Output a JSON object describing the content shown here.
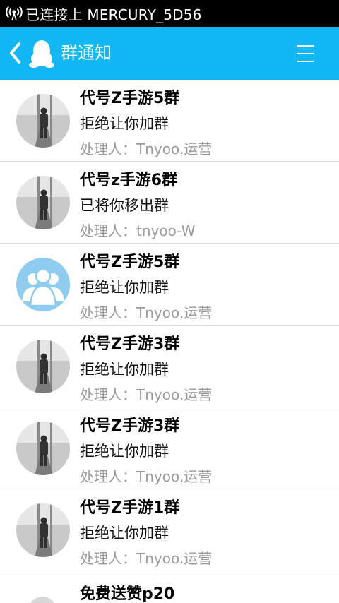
{
  "status_bar": {
    "text": "已连接上 MERCURY_5D56",
    "wifi_icon": "wifi-signal-icon"
  },
  "header": {
    "title": "群通知",
    "back_icon": "chevron-left-icon",
    "logo_icon": "qq-penguin-icon",
    "menu_icon": "hamburger-menu-icon",
    "background_color": "#12b7f5"
  },
  "notifications": [
    {
      "group": "代号Z手游5群",
      "message": "拒绝让你加群",
      "handler": "处理人：Tnyoo.运营",
      "avatar": "photo"
    },
    {
      "group": "代号z手游6群",
      "message": "已将你移出群",
      "handler": "处理人：tnyoo-W",
      "avatar": "photo"
    },
    {
      "group": "代号Z手游5群",
      "message": "拒绝让你加群",
      "handler": "处理人：Tnyoo.运营",
      "avatar": "group-default"
    },
    {
      "group": "代号Z手游3群",
      "message": "拒绝让你加群",
      "handler": "处理人：Tnyoo.运营",
      "avatar": "photo"
    },
    {
      "group": "代号Z手游3群",
      "message": "拒绝让你加群",
      "handler": "处理人：Tnyoo.运营",
      "avatar": "photo"
    },
    {
      "group": "代号Z手游1群",
      "message": "拒绝让你加群",
      "handler": "处理人：Tnyoo.运营",
      "avatar": "photo"
    }
  ],
  "partial_item": {
    "group": "免费送赞p20"
  }
}
